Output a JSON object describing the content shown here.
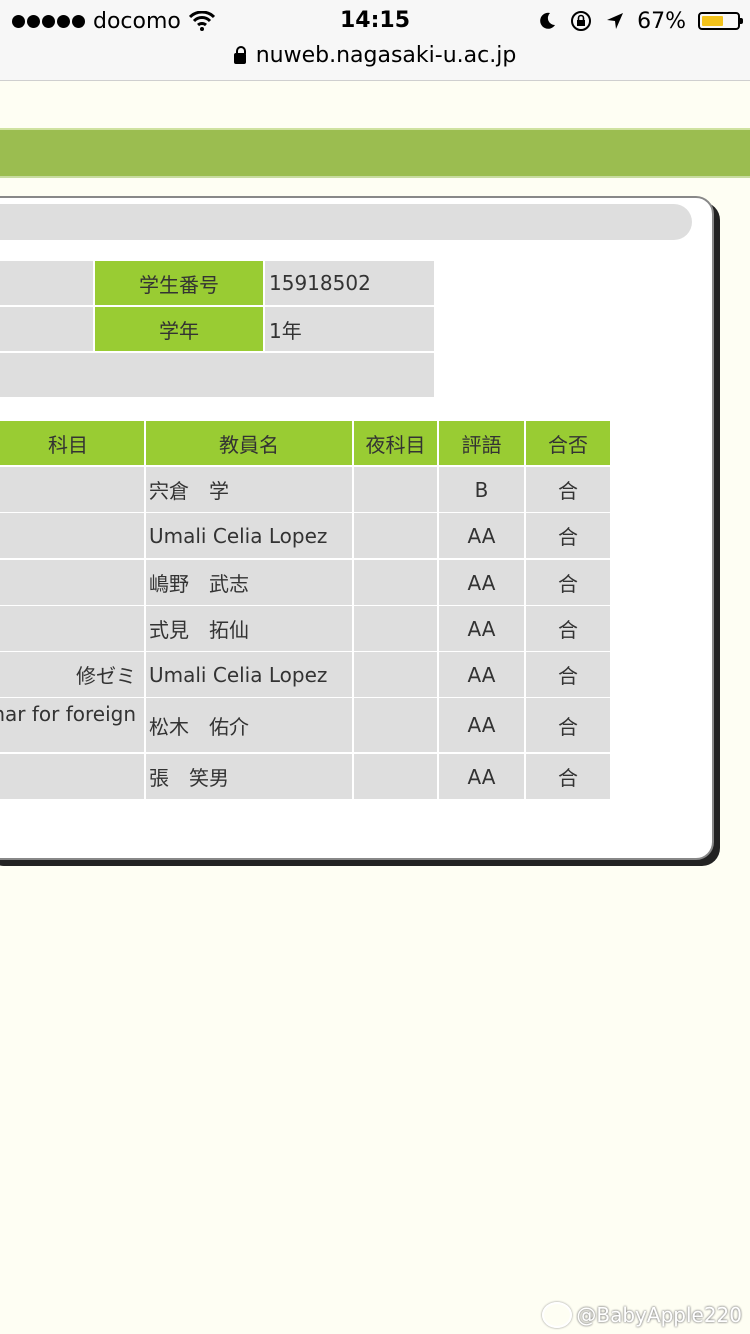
{
  "status": {
    "carrier": "docomo",
    "time": "14:15",
    "battery": "67%",
    "battery_level": 0.67,
    "url": "nuweb.nagasaki-u.ac.jp"
  },
  "info": {
    "student_id_label": "学生番号",
    "student_id": "15918502",
    "year_label": "学年",
    "year": "1年"
  },
  "grades": {
    "headers": [
      "科目",
      "教員名",
      "夜科目",
      "評語",
      "合否"
    ],
    "rows": [
      {
        "subject": "",
        "teacher": "宍倉　学",
        "night": "",
        "grade": "B",
        "pass": "合"
      },
      {
        "subject": "",
        "teacher": "Umali Celia Lopez",
        "night": "",
        "grade": "AA",
        "pass": "合"
      },
      {
        "subject": "",
        "teacher": "嶋野　武志",
        "night": "",
        "grade": "AA",
        "pass": "合"
      },
      {
        "subject": "",
        "teacher": "式見　拓仙",
        "night": "",
        "grade": "AA",
        "pass": "合"
      },
      {
        "subject": "修ゼミ",
        "teacher": "Umali Celia Lopez",
        "night": "",
        "grade": "AA",
        "pass": "合"
      },
      {
        "subject": "nar for foreign",
        "teacher": "松木　佑介",
        "night": "",
        "grade": "AA",
        "pass": "合"
      },
      {
        "subject": "",
        "teacher": "張　笑男",
        "night": "",
        "grade": "AA",
        "pass": "合"
      }
    ]
  },
  "watermark": "@BabyApple220"
}
